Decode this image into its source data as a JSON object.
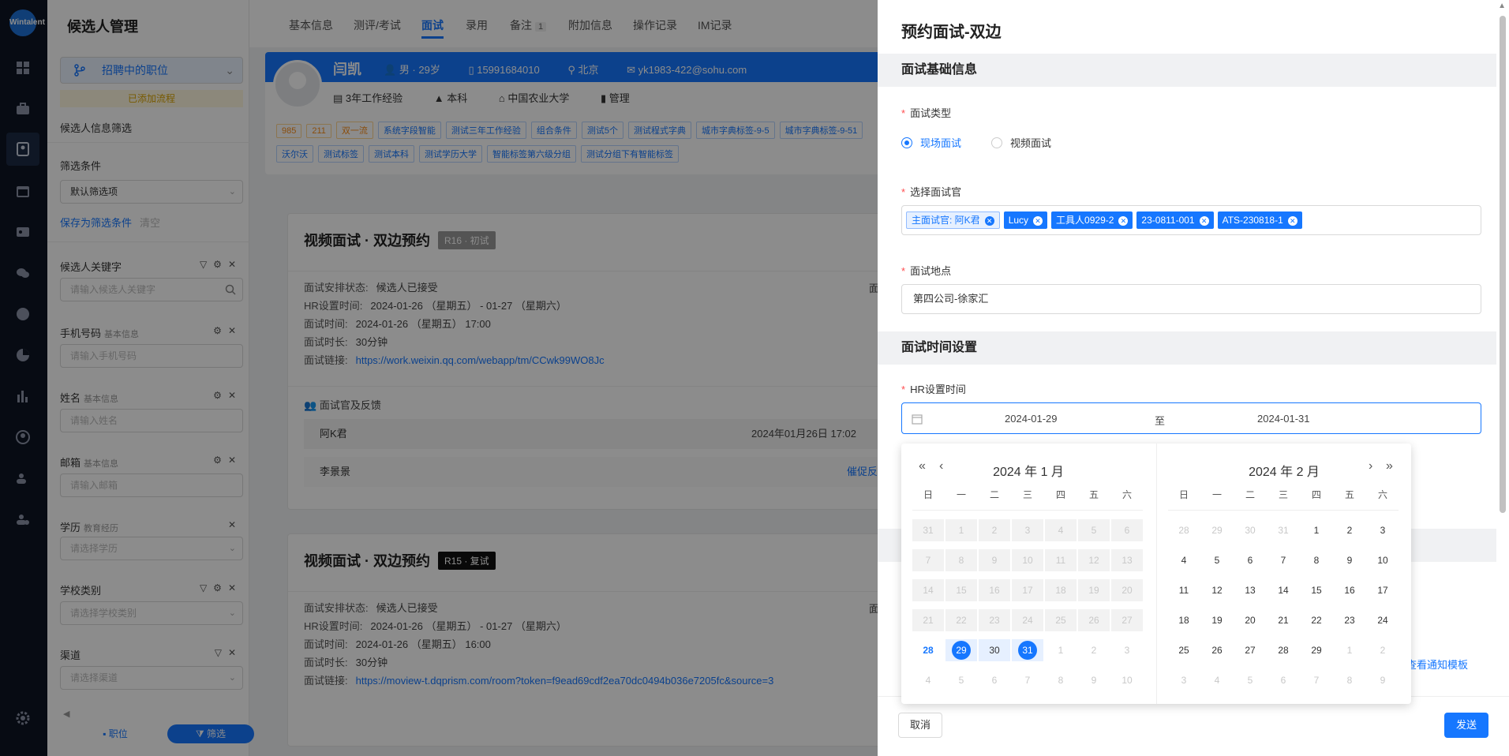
{
  "rail": {
    "logo": "Wintalent"
  },
  "filter": {
    "title": "候选人管理",
    "position_select": "招聘中的职位",
    "warning": "已添加流程",
    "section_label": "候选人信息筛选",
    "condition_label": "筛选条件",
    "condition_value": "默认筛选项",
    "save_link": "保存为筛选条件",
    "clear_link": "清空",
    "fields": [
      {
        "label": "候选人关键字",
        "sub": "",
        "placeholder": "请输入候选人关键字"
      },
      {
        "label": "手机号码",
        "sub": "基本信息",
        "placeholder": "请输入手机号码"
      },
      {
        "label": "姓名",
        "sub": "基本信息",
        "placeholder": "请输入姓名"
      },
      {
        "label": "邮箱",
        "sub": "基本信息",
        "placeholder": "请输入邮箱"
      },
      {
        "label": "学历",
        "sub": "教育经历",
        "placeholder": "请选择学历"
      },
      {
        "label": "学校类别",
        "sub": "",
        "placeholder": "请选择学校类别"
      },
      {
        "label": "渠道",
        "sub": "",
        "placeholder": "请选择渠道"
      }
    ],
    "footer_left": "职位",
    "footer_right": "筛选"
  },
  "tabs": [
    {
      "label": "基本信息"
    },
    {
      "label": "测评/考试"
    },
    {
      "label": "面试"
    },
    {
      "label": "录用"
    },
    {
      "label": "备注",
      "count": "1"
    },
    {
      "label": "附加信息"
    },
    {
      "label": "操作记录"
    },
    {
      "label": "IM记录"
    }
  ],
  "profile": {
    "name": "闫凯",
    "gender_age": "男 · 29岁",
    "phone": "15991684010",
    "city": "北京",
    "email": "yk1983-422@sohu.com",
    "experience": "3年工作经验",
    "degree": "本科",
    "school": "中国农业大学",
    "major": "管理",
    "tags": [
      "985",
      "211",
      "双一流",
      "系统字段智能",
      "测试三年工作经验",
      "组合条件",
      "测试5个",
      "测试程式字典",
      "城市字典标签-9-5",
      "城市字典标签-9-51",
      "沃尔沃",
      "测试标签",
      "测试本科",
      "测试学历大学",
      "智能标签第六级分组",
      "测试分组下有智能标签"
    ]
  },
  "cards": [
    {
      "title": "视频面试 · 双边预约",
      "badge": "R16 · 初试",
      "status_k": "面试安排状态:",
      "status_v": "候选人已接受",
      "hr_k": "HR设置时间:",
      "hr_v": "2024-01-26 （星期五） - 01-27 （星期六）",
      "time_k": "面试时间:",
      "time_v": "2024-01-26 （星期五） 17:00",
      "dur_k": "面试时长:",
      "dur_v": "30分钟",
      "link_k": "面试链接:",
      "link_v": "https://work.weixin.qq.com/webapp/tm/CCwk99WO8Jc",
      "right_cut": "面",
      "fb_title": "面试官及反馈",
      "fb": [
        {
          "name": "阿K君",
          "date": "2024年01月26日 17:02",
          "link": ""
        },
        {
          "name": "李景景",
          "date": "",
          "link": "催促反馈"
        }
      ]
    },
    {
      "title": "视频面试 · 双边预约",
      "badge": "R15 · 复试",
      "status_k": "面试安排状态:",
      "status_v": "候选人已接受",
      "hr_k": "HR设置时间:",
      "hr_v": "2024-01-26 （星期五） - 01-27 （星期六）",
      "time_k": "面试时间:",
      "time_v": "2024-01-26 （星期五） 16:00",
      "dur_k": "面试时长:",
      "dur_v": "30分钟",
      "link_k": "面试链接:",
      "link_v": "https://moview-t.dqprism.com/room?token=f9ead69cdf2ea70dc0494b036e7205fc&source=3",
      "right_cut": "面"
    }
  ],
  "drawer": {
    "title": "预约面试-双边",
    "section_basic": "面试基础信息",
    "type_label": "面试类型",
    "type_options": [
      "现场面试",
      "视频面试"
    ],
    "type_selected": "现场面试",
    "interviewer_label": "选择面试官",
    "interviewers": [
      "主面试官: 阿K君",
      "Lucy",
      "工具人0929-2",
      "23-0811-001",
      "ATS-230818-1"
    ],
    "location_label": "面试地点",
    "location_value": "第四公司-徐家汇",
    "section_time": "面试时间设置",
    "hr_time_label": "HR设置时间",
    "range_start": "2024-01-29",
    "range_sep": "至",
    "range_end": "2024-01-31",
    "template_link": "查看通知模板",
    "cancel": "取消",
    "send": "发送"
  },
  "picker": {
    "weekdays": [
      "日",
      "一",
      "二",
      "三",
      "四",
      "五",
      "六"
    ],
    "left_title": "2024 年 1 月",
    "right_title": "2024 年 2 月",
    "left_days": [
      [
        "31",
        "1",
        "2",
        "3",
        "4",
        "5",
        "6"
      ],
      [
        "7",
        "8",
        "9",
        "10",
        "11",
        "12",
        "13"
      ],
      [
        "14",
        "15",
        "16",
        "17",
        "18",
        "19",
        "20"
      ],
      [
        "21",
        "22",
        "23",
        "24",
        "25",
        "26",
        "27"
      ],
      [
        "28",
        "29",
        "30",
        "31",
        "1",
        "2",
        "3"
      ],
      [
        "4",
        "5",
        "6",
        "7",
        "8",
        "9",
        "10"
      ]
    ],
    "right_days": [
      [
        "28",
        "29",
        "30",
        "31",
        "1",
        "2",
        "3"
      ],
      [
        "4",
        "5",
        "6",
        "7",
        "8",
        "9",
        "10"
      ],
      [
        "11",
        "12",
        "13",
        "14",
        "15",
        "16",
        "17"
      ],
      [
        "18",
        "19",
        "20",
        "21",
        "22",
        "23",
        "24"
      ],
      [
        "25",
        "26",
        "27",
        "28",
        "29",
        "1",
        "2"
      ],
      [
        "3",
        "4",
        "5",
        "6",
        "7",
        "8",
        "9"
      ]
    ]
  }
}
